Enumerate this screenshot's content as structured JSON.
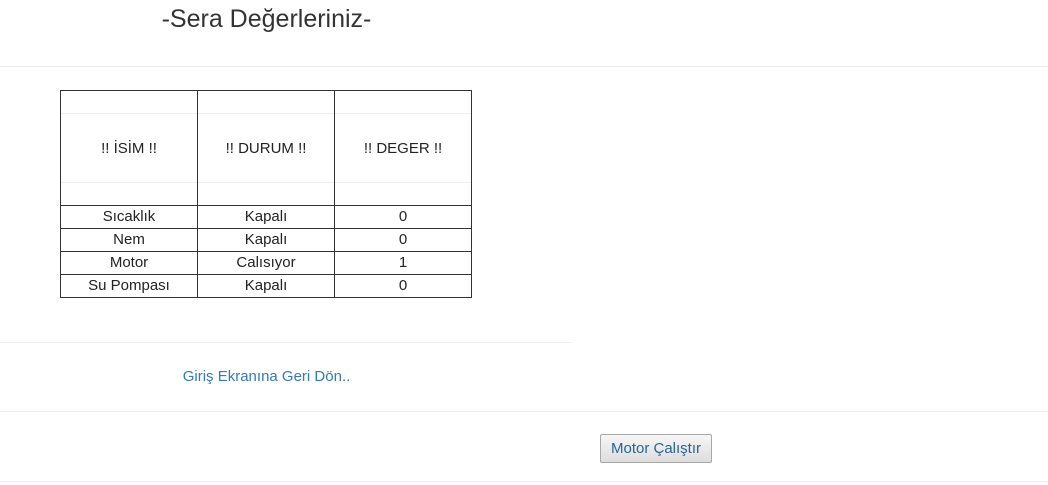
{
  "header": {
    "title": "-Sera Değerleriniz-"
  },
  "table": {
    "columns": [
      "!! İSİM !!",
      "!! DURUM !!",
      "!! DEGER !!"
    ],
    "rows": [
      {
        "isim": "Sıcaklık",
        "durum": "Kapalı",
        "deger": "0"
      },
      {
        "isim": "Nem",
        "durum": "Kapalı",
        "deger": "0"
      },
      {
        "isim": "Motor",
        "durum": "Calısıyor",
        "deger": "1"
      },
      {
        "isim": "Su Pompası",
        "durum": "Kapalı",
        "deger": "0"
      }
    ]
  },
  "links": {
    "back_label": "Giriş Ekranına Geri Dön.."
  },
  "actions": {
    "motor_button_label": "Motor Çalıştır"
  },
  "colors": {
    "link": "#337ab7",
    "text": "#333333",
    "table_border": "#333333",
    "divider": "#eeeeee"
  }
}
